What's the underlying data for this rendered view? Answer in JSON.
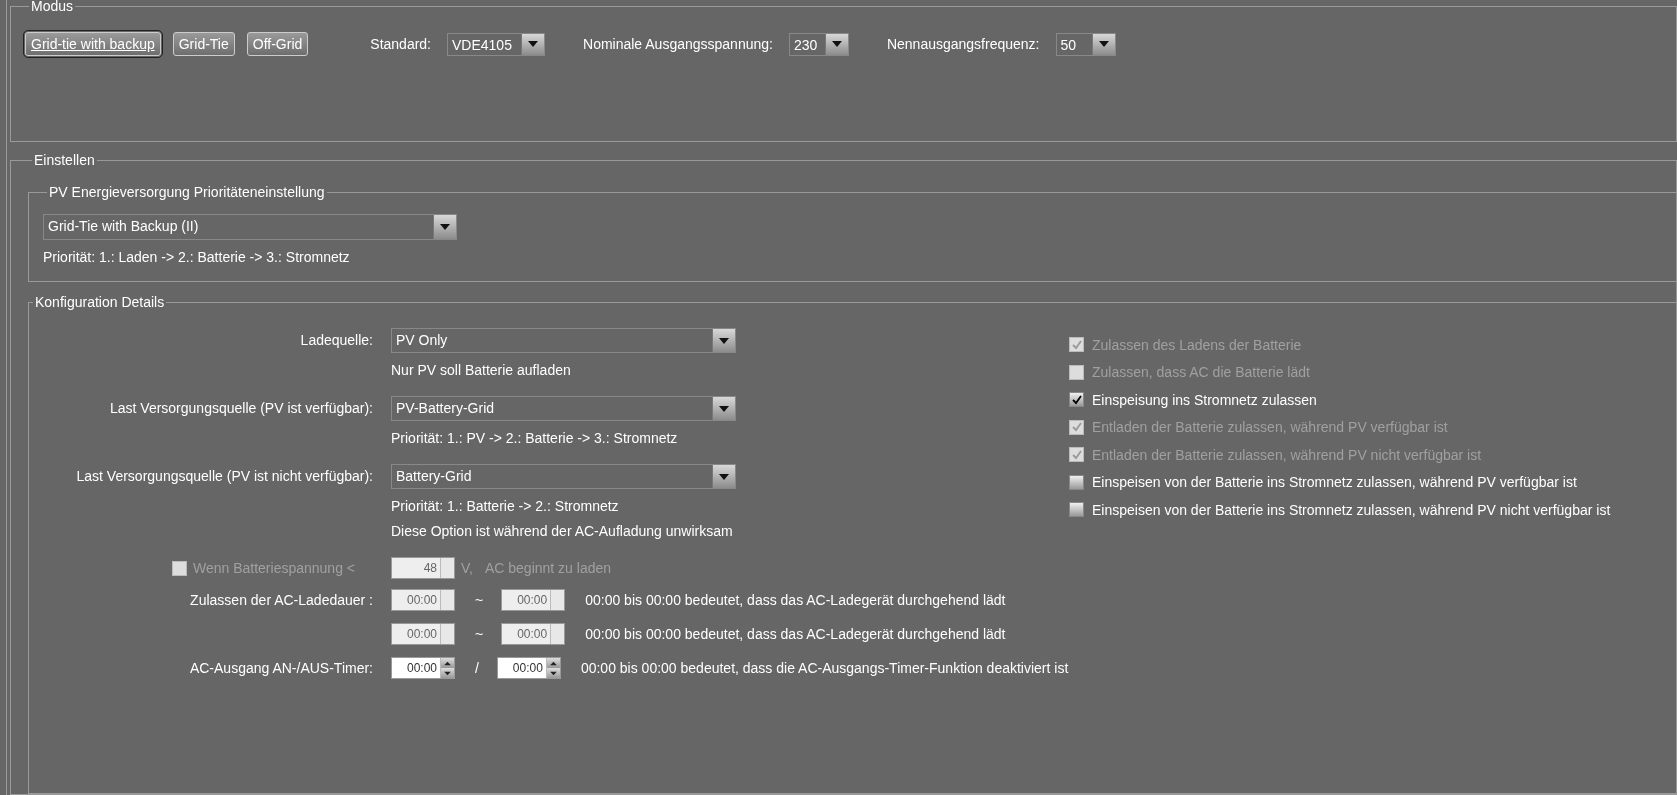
{
  "modus": {
    "legend": "Modus",
    "buttons": [
      {
        "label": "Grid-tie with backup",
        "selected": true
      },
      {
        "label": "Grid-Tie",
        "selected": false
      },
      {
        "label": "Off-Grid",
        "selected": false
      }
    ],
    "selects": [
      {
        "label": "Standard:",
        "value": "VDE4105"
      },
      {
        "label": "Nominale Ausgangsspannung:",
        "value": "230"
      },
      {
        "label": "Nennausgangsfrequenz:",
        "value": "50"
      }
    ]
  },
  "einstellen": {
    "legend": "Einstellen",
    "pv_priority": {
      "legend": "PV Energieversorgung Prioritäteneinstellung",
      "value": "Grid-Tie with Backup (II)",
      "note": "Priorität: 1.: Laden -> 2.: Batterie -> 3.: Stromnetz"
    },
    "config": {
      "legend": "Konfiguration Details",
      "rows": [
        {
          "kind": "select",
          "label": "Ladequelle:",
          "value": "PV Only",
          "notes": [
            "Nur PV soll Batterie aufladen"
          ]
        },
        {
          "kind": "select",
          "label": "Last Versorgungsquelle (PV ist verfügbar):",
          "value": "PV-Battery-Grid",
          "notes": [
            "Priorität: 1.: PV -> 2.: Batterie -> 3.: Stromnetz"
          ]
        },
        {
          "kind": "select",
          "label": "Last Versorgungsquelle (PV ist nicht verfügbar):",
          "value": "Battery-Grid",
          "notes": [
            "Priorität: 1.: Batterie -> 2.: Stromnetz",
            "Diese Option ist während der AC-Aufladung unwirksam"
          ]
        },
        {
          "kind": "threshold",
          "label": "Wenn Batteriespannung <",
          "checked": false,
          "disabled": true,
          "value": "48",
          "unit": "V,",
          "suffix": "AC beginnt zu laden"
        },
        {
          "kind": "range",
          "label": "Zulassen der AC-Ladedauer :",
          "from": "00:00",
          "separator": "~",
          "to": "00:00",
          "note": "00:00 bis 00:00 bedeutet, dass das AC-Ladegerät durchgehend lädt",
          "disabled": true
        },
        {
          "kind": "range",
          "from": "00:00",
          "separator": "~",
          "to": "00:00",
          "note": "00:00 bis 00:00 bedeutet, dass das AC-Ladegerät durchgehend lädt",
          "disabled": true
        },
        {
          "kind": "range",
          "label": "AC-Ausgang AN-/AUS-Timer:",
          "from": "00:00",
          "separator": "/",
          "to": "00:00",
          "note": "00:00 bis 00:00 bedeutet, dass die AC-Ausgangs-Timer-Funktion deaktiviert ist",
          "disabled": false
        }
      ],
      "checkboxes": [
        {
          "label": "Zulassen des Ladens der Batterie",
          "checked": true,
          "disabled": true
        },
        {
          "label": "Zulassen, dass AC die Batterie lädt",
          "checked": false,
          "disabled": true
        },
        {
          "label": "Einspeisung ins Stromnetz zulassen",
          "checked": true,
          "disabled": false
        },
        {
          "label": "Entladen der Batterie zulassen, während PV verfügbar ist",
          "checked": true,
          "disabled": true
        },
        {
          "label": "Entladen der Batterie zulassen, während PV nicht verfügbar ist",
          "checked": true,
          "disabled": true
        },
        {
          "label": "Einspeisen von der Batterie ins Stromnetz zulassen, während PV verfügbar ist",
          "checked": false,
          "disabled": false
        },
        {
          "label": "Einspeisen von der Batterie ins Stromnetz zulassen, während PV nicht verfügbar ist",
          "checked": false,
          "disabled": false
        }
      ]
    }
  }
}
